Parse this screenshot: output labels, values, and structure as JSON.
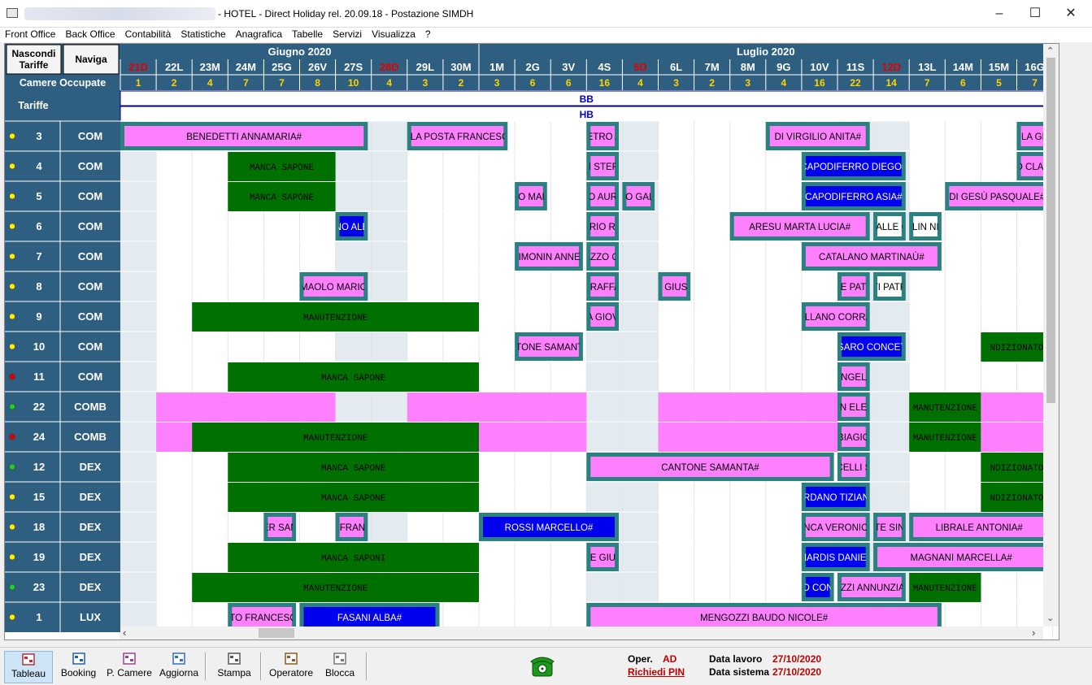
{
  "window": {
    "title": "- HOTEL - Direct Holiday rel. 20.09.18 - Postazione SIMDH",
    "min_icon": "minimize-icon",
    "max_icon": "maximize-icon",
    "close_icon": "close-icon"
  },
  "menu": [
    "Front Office",
    "Back Office",
    "Contabilità",
    "Statistiche",
    "Anagrafica",
    "Tabelle",
    "Servizi",
    "Visualizza",
    "?"
  ],
  "header": {
    "hide_rates_label": "Nascondi Tariffe",
    "navigate_label": "Naviga",
    "occupied_label": "Camere Occupate",
    "rates_label": "Tariffe",
    "months": [
      {
        "label": "Giugno 2020",
        "span": 10
      },
      {
        "label": "Luglio 2020",
        "span": 16
      }
    ]
  },
  "days": [
    {
      "label": "21D",
      "occ": "1",
      "red": true
    },
    {
      "label": "22L",
      "occ": "2",
      "red": false
    },
    {
      "label": "23M",
      "occ": "4",
      "red": false
    },
    {
      "label": "24M",
      "occ": "7",
      "red": false
    },
    {
      "label": "25G",
      "occ": "7",
      "red": false
    },
    {
      "label": "26V",
      "occ": "8",
      "red": false
    },
    {
      "label": "27S",
      "occ": "10",
      "red": false
    },
    {
      "label": "28D",
      "occ": "4",
      "red": true
    },
    {
      "label": "29L",
      "occ": "3",
      "red": false
    },
    {
      "label": "30M",
      "occ": "2",
      "red": false
    },
    {
      "label": "1M",
      "occ": "3",
      "red": false
    },
    {
      "label": "2G",
      "occ": "6",
      "red": false
    },
    {
      "label": "3V",
      "occ": "6",
      "red": false
    },
    {
      "label": "4S",
      "occ": "16",
      "red": false
    },
    {
      "label": "5D",
      "occ": "4",
      "red": true
    },
    {
      "label": "6L",
      "occ": "3",
      "red": false
    },
    {
      "label": "7M",
      "occ": "2",
      "red": false
    },
    {
      "label": "8M",
      "occ": "3",
      "red": false
    },
    {
      "label": "9G",
      "occ": "4",
      "red": false
    },
    {
      "label": "10V",
      "occ": "16",
      "red": false
    },
    {
      "label": "11S",
      "occ": "22",
      "red": false
    },
    {
      "label": "12D",
      "occ": "14",
      "red": true
    },
    {
      "label": "13L",
      "occ": "7",
      "red": false
    },
    {
      "label": "14M",
      "occ": "6",
      "red": false
    },
    {
      "label": "15M",
      "occ": "5",
      "red": false
    },
    {
      "label": "16G",
      "occ": "7",
      "red": false
    }
  ],
  "shaded_days": [
    0,
    6,
    7,
    13,
    14,
    20,
    21
  ],
  "rate_rows": [
    "BB",
    "HB"
  ],
  "rooms": [
    {
      "num": "3",
      "type": "COM",
      "dot": "#ffee00"
    },
    {
      "num": "4",
      "type": "COM",
      "dot": "#ffee00"
    },
    {
      "num": "5",
      "type": "COM",
      "dot": "#ffee00"
    },
    {
      "num": "6",
      "type": "COM",
      "dot": "#ffee00"
    },
    {
      "num": "7",
      "type": "COM",
      "dot": "#ffee00"
    },
    {
      "num": "8",
      "type": "COM",
      "dot": "#ffee00"
    },
    {
      "num": "9",
      "type": "COM",
      "dot": "#ffee00"
    },
    {
      "num": "10",
      "type": "COM",
      "dot": "#ffee00"
    },
    {
      "num": "11",
      "type": "COM",
      "dot": "#e00000"
    },
    {
      "num": "22",
      "type": "COMB",
      "dot": "#22cc22"
    },
    {
      "num": "24",
      "type": "COMB",
      "dot": "#e00000"
    },
    {
      "num": "12",
      "type": "DEX",
      "dot": "#22cc22"
    },
    {
      "num": "15",
      "type": "DEX",
      "dot": "#ffee00"
    },
    {
      "num": "18",
      "type": "DEX",
      "dot": "#ffee00"
    },
    {
      "num": "19",
      "type": "DEX",
      "dot": "#ffee00"
    },
    {
      "num": "23",
      "type": "DEX",
      "dot": "#22cc22"
    },
    {
      "num": "1",
      "type": "LUX",
      "dot": "#ffee00"
    }
  ],
  "colors": {
    "header_bg": "#2f5f80",
    "header_text": "#ffffff",
    "occ_text": "#ffd400",
    "red_day": "#e00000",
    "pink": "#ff80ff",
    "blue": "#0000ee",
    "green": "#007000",
    "border_teal": "#2b8080",
    "shade": "#e3ebf1"
  },
  "bookings": [
    {
      "row": 0,
      "start": 0,
      "end": 6.9,
      "name": "BENEDETTI ANNAMARIA#",
      "kind": "pink",
      "frame": true
    },
    {
      "row": 0,
      "start": 8,
      "end": 10.8,
      "name": "ELLA POSTA FRANCESCO",
      "kind": "pink",
      "frame": true
    },
    {
      "row": 0,
      "start": 13,
      "end": 13.9,
      "name": "IETRO A",
      "kind": "pink",
      "frame": true
    },
    {
      "row": 0,
      "start": 18,
      "end": 20.9,
      "name": "DI VIRGILIO ANITA#",
      "kind": "pink",
      "frame": true
    },
    {
      "row": 0,
      "start": 25,
      "end": 25.9,
      "name": "LA GI",
      "kind": "pink",
      "frame": true
    },
    {
      "row": 1,
      "start": 3,
      "end": 6,
      "name": "MANCA  SAPONE",
      "kind": "green",
      "frame": false
    },
    {
      "row": 1,
      "start": 13,
      "end": 13.9,
      "name": "NI STEFA",
      "kind": "pink",
      "frame": true
    },
    {
      "row": 1,
      "start": 19,
      "end": 21.9,
      "name": "CAPODIFERRO DIEGO#",
      "kind": "blue",
      "frame": true
    },
    {
      "row": 1,
      "start": 25,
      "end": 25.9,
      "name": "O CLAU",
      "kind": "pink",
      "frame": true
    },
    {
      "row": 2,
      "start": 3,
      "end": 6,
      "name": "MANCA  SAPONE",
      "kind": "green",
      "frame": false
    },
    {
      "row": 2,
      "start": 11,
      "end": 11.9,
      "name": "LO MAR",
      "kind": "pink",
      "frame": true
    },
    {
      "row": 2,
      "start": 13,
      "end": 13.9,
      "name": "IO AURI",
      "kind": "pink",
      "frame": true
    },
    {
      "row": 2,
      "start": 14,
      "end": 14.9,
      "name": "IO GAL",
      "kind": "pink",
      "frame": true
    },
    {
      "row": 2,
      "start": 19,
      "end": 21.9,
      "name": "CAPODIFERRO ASIA#",
      "kind": "blue",
      "frame": true
    },
    {
      "row": 2,
      "start": 23,
      "end": 25.9,
      "name": "DI GESÙ PASQUALE#",
      "kind": "pink",
      "frame": true
    },
    {
      "row": 3,
      "start": 6,
      "end": 6.9,
      "name": "NO ALE",
      "kind": "blue",
      "frame": true
    },
    {
      "row": 3,
      "start": 13,
      "end": 13.9,
      "name": "ARIO RU",
      "kind": "pink",
      "frame": true
    },
    {
      "row": 3,
      "start": 17,
      "end": 20.9,
      "name": "ARESU MARTA LUCIA#",
      "kind": "pink",
      "frame": true
    },
    {
      "row": 3,
      "start": 21,
      "end": 21.9,
      "name": "VALLE G",
      "kind": "white",
      "frame": true
    },
    {
      "row": 3,
      "start": 22,
      "end": 22.9,
      "name": "OLIN NIC",
      "kind": "white",
      "frame": true
    },
    {
      "row": 4,
      "start": 11,
      "end": 12.9,
      "name": "SIMONIN ANNE#",
      "kind": "pink",
      "frame": true
    },
    {
      "row": 4,
      "start": 13,
      "end": 13.9,
      "name": "AZZO CI",
      "kind": "pink",
      "frame": true
    },
    {
      "row": 4,
      "start": 19,
      "end": 22.9,
      "name": "CATALANO MARTINAÙ#",
      "kind": "pink",
      "frame": true
    },
    {
      "row": 5,
      "start": 5,
      "end": 6.9,
      "name": "I MAOLO MARIO#",
      "kind": "pink",
      "frame": true
    },
    {
      "row": 5,
      "start": 13,
      "end": 13.9,
      "name": "I RAFFA",
      "kind": "pink",
      "frame": true
    },
    {
      "row": 5,
      "start": 15,
      "end": 15.9,
      "name": "N GIUSE",
      "kind": "pink",
      "frame": true
    },
    {
      "row": 5,
      "start": 20,
      "end": 20.9,
      "name": "SE PATR",
      "kind": "pink",
      "frame": true
    },
    {
      "row": 5,
      "start": 21,
      "end": 21.9,
      "name": "TI PATR",
      "kind": "white",
      "frame": true
    },
    {
      "row": 6,
      "start": 2,
      "end": 10,
      "name": "MANUTENZIONE",
      "kind": "green",
      "frame": false
    },
    {
      "row": 6,
      "start": 13,
      "end": 13.9,
      "name": "A  GIOV",
      "kind": "pink",
      "frame": true
    },
    {
      "row": 6,
      "start": 19,
      "end": 20.9,
      "name": "TELLANO CORRAD",
      "kind": "pink",
      "frame": true
    },
    {
      "row": 7,
      "start": 11,
      "end": 12.9,
      "name": "NTONE SAMANTA",
      "kind": "pink",
      "frame": true
    },
    {
      "row": 7,
      "start": 20,
      "end": 21.9,
      "name": "SSARO CONCETT",
      "kind": "blue",
      "frame": true
    },
    {
      "row": 7,
      "start": 24,
      "end": 26,
      "name": "NDIZIONATO",
      "kind": "green",
      "frame": false
    },
    {
      "row": 8,
      "start": 3,
      "end": 10,
      "name": "MANCA  SAPONE",
      "kind": "green",
      "frame": false
    },
    {
      "row": 8,
      "start": 20,
      "end": 20.9,
      "name": "ANGELA",
      "kind": "pink",
      "frame": true
    },
    {
      "row": 9,
      "start": 1,
      "end": 6,
      "name": "",
      "kind": "pinkfill",
      "frame": false
    },
    {
      "row": 9,
      "start": 8,
      "end": 13,
      "name": "",
      "kind": "pinkfill",
      "frame": false
    },
    {
      "row": 9,
      "start": 15,
      "end": 20,
      "name": "",
      "kind": "pinkfill",
      "frame": false
    },
    {
      "row": 9,
      "start": 20,
      "end": 20.9,
      "name": "AN ELEN",
      "kind": "pink",
      "frame": true
    },
    {
      "row": 9,
      "start": 22,
      "end": 24,
      "name": "MANUTENZIONE",
      "kind": "green",
      "frame": false
    },
    {
      "row": 9,
      "start": 24,
      "end": 26,
      "name": "",
      "kind": "pinkfill",
      "frame": false
    },
    {
      "row": 10,
      "start": 1,
      "end": 2,
      "name": "",
      "kind": "pinkfill",
      "frame": false
    },
    {
      "row": 10,
      "start": 2,
      "end": 10,
      "name": "MANUTENZIONE",
      "kind": "green",
      "frame": false
    },
    {
      "row": 10,
      "start": 10,
      "end": 13,
      "name": "",
      "kind": "pinkfill",
      "frame": false
    },
    {
      "row": 10,
      "start": 15,
      "end": 20,
      "name": "",
      "kind": "pinkfill",
      "frame": false
    },
    {
      "row": 10,
      "start": 20,
      "end": 20.9,
      "name": "BIAGIO",
      "kind": "pink",
      "frame": true
    },
    {
      "row": 10,
      "start": 22,
      "end": 24,
      "name": "MANUTENZIONE",
      "kind": "green",
      "frame": false
    },
    {
      "row": 10,
      "start": 24,
      "end": 26,
      "name": "",
      "kind": "pinkfill",
      "frame": false
    },
    {
      "row": 11,
      "start": 3,
      "end": 10,
      "name": "MANCA  SAPONE",
      "kind": "green",
      "frame": false
    },
    {
      "row": 11,
      "start": 13,
      "end": 19.9,
      "name": "CANTONE SAMANTA#",
      "kind": "pink",
      "frame": true
    },
    {
      "row": 11,
      "start": 20,
      "end": 20.9,
      "name": "CELLI S",
      "kind": "pink",
      "frame": true
    },
    {
      "row": 11,
      "start": 24,
      "end": 26,
      "name": "NDIZIONATO",
      "kind": "green",
      "frame": false
    },
    {
      "row": 12,
      "start": 3,
      "end": 10,
      "name": "MANCA  SAPONE",
      "kind": "green",
      "frame": false
    },
    {
      "row": 12,
      "start": 19,
      "end": 20.9,
      "name": "ORDANO TIZIANA",
      "kind": "blue",
      "frame": true
    },
    {
      "row": 12,
      "start": 24,
      "end": 26,
      "name": "NDIZIONATO",
      "kind": "green",
      "frame": false
    },
    {
      "row": 13,
      "start": 4,
      "end": 4.9,
      "name": "ER SAN",
      "kind": "pink",
      "frame": true
    },
    {
      "row": 13,
      "start": 6,
      "end": 6.9,
      "name": "A FRANC",
      "kind": "pink",
      "frame": true
    },
    {
      "row": 13,
      "start": 10,
      "end": 13.9,
      "name": "ROSSI MARCELLO#",
      "kind": "blue",
      "frame": true
    },
    {
      "row": 13,
      "start": 19,
      "end": 20.9,
      "name": "ENCA VERONICA",
      "kind": "pink",
      "frame": true
    },
    {
      "row": 13,
      "start": 21,
      "end": 21.9,
      "name": "ITE SINI",
      "kind": "pink",
      "frame": true
    },
    {
      "row": 13,
      "start": 22,
      "end": 25.9,
      "name": "LIBRALE ANTONIA#",
      "kind": "pink",
      "frame": true
    },
    {
      "row": 14,
      "start": 3,
      "end": 10,
      "name": "MANCA  SAPONI",
      "kind": "green",
      "frame": false
    },
    {
      "row": 14,
      "start": 13,
      "end": 13.9,
      "name": "NE GIUS",
      "kind": "pink",
      "frame": true
    },
    {
      "row": 14,
      "start": 19,
      "end": 20.9,
      "name": "NARDIS DANIEL",
      "kind": "blue",
      "frame": true
    },
    {
      "row": 14,
      "start": 21,
      "end": 25.9,
      "name": "MAGNANI MARCELLA#",
      "kind": "pink",
      "frame": true
    },
    {
      "row": 15,
      "start": 2,
      "end": 10,
      "name": "MANUTENZIONE",
      "kind": "green",
      "frame": false
    },
    {
      "row": 15,
      "start": 19,
      "end": 19.9,
      "name": "RO CONC",
      "kind": "blue",
      "frame": true
    },
    {
      "row": 15,
      "start": 20,
      "end": 21.9,
      "name": "OZZI  ANNUNZIAT",
      "kind": "pink",
      "frame": true
    },
    {
      "row": 15,
      "start": 22,
      "end": 24,
      "name": "MANUTENZIONE",
      "kind": "green",
      "frame": false
    },
    {
      "row": 16,
      "start": 3,
      "end": 4.9,
      "name": "DITO FRANCESCO",
      "kind": "pink",
      "frame": true
    },
    {
      "row": 16,
      "start": 5,
      "end": 8.9,
      "name": "FASANI ALBA#",
      "kind": "blue",
      "frame": true
    },
    {
      "row": 16,
      "start": 13,
      "end": 22.9,
      "name": "MENGOZZI BAUDO NICOLE#",
      "kind": "pink",
      "frame": true
    }
  ],
  "toolbar": [
    {
      "label": "Tableau",
      "icon": "tableau-icon",
      "active": true
    },
    {
      "label": "Booking",
      "icon": "booking-icon",
      "active": false
    },
    {
      "label": "P. Camere",
      "icon": "rooms-plan-icon",
      "active": false
    },
    {
      "label": "Aggiorna",
      "icon": "refresh-icon",
      "active": false
    },
    {
      "label": "Stampa",
      "icon": "print-icon",
      "active": false
    },
    {
      "label": "Operatore",
      "icon": "operator-icon",
      "active": false
    },
    {
      "label": "Blocca",
      "icon": "lock-icon",
      "active": false
    }
  ],
  "status": {
    "oper_label": "Oper.",
    "oper_value": "AD",
    "pin_link": "Richiedi PIN",
    "work_date_label": "Data lavoro",
    "work_date_value": "27/10/2020",
    "system_date_label": "Data sistema",
    "system_date_value": "27/10/2020",
    "phone_icon": "telephone-icon"
  }
}
